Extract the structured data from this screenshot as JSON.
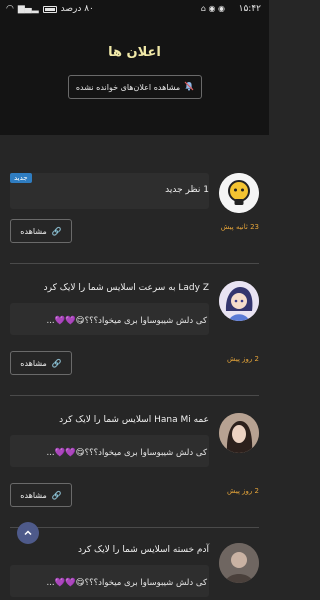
{
  "status_bar": {
    "time": "۱۵:۴۲",
    "battery_percent": "۸۰ درصد",
    "colors": {
      "background": "#141414"
    }
  },
  "header": {
    "title": "اعلان ها",
    "unread_button_label": "مشاهده اعلان‌های خوانده نشده",
    "unread_button_icon": "bell-off-icon"
  },
  "notifications": [
    {
      "title": "1 نظر جدید",
      "badge": "جدید",
      "snippet": "",
      "time": "23 ثانیه پیش",
      "action_label": "مشاهده",
      "avatar": "lightbulb-logo"
    },
    {
      "title": "Lady Z به سرعت اسلایس شما را لایک کرد",
      "badge": "",
      "snippet": "کی دلش شیبوساوا بری میخواد؟؟؟😋💜💜...",
      "time": "2 روز پیش",
      "action_label": "مشاهده",
      "avatar": "anime-girl-avatar"
    },
    {
      "title": "عمه Hana Mi اسلایس شما را لایک کرد",
      "badge": "",
      "snippet": "کی دلش شیبوساوا بری میخواد؟؟؟😋💜💜...",
      "time": "2 روز پیش",
      "action_label": "مشاهده",
      "avatar": "girl-photo-avatar"
    },
    {
      "title": "آدم خسته اسلایس شما را لایک کرد",
      "badge": "",
      "snippet": "کی دلش شیبوساوا بری میخواد؟؟؟😋💜💜...",
      "time": "",
      "action_label": "",
      "avatar": "photo-avatar"
    }
  ],
  "scroll_top_icon": "chevron-up-icon",
  "colors": {
    "accent_time": "#e6a53a",
    "badge": "#2f7dc1",
    "title": "#f1e9a8"
  }
}
